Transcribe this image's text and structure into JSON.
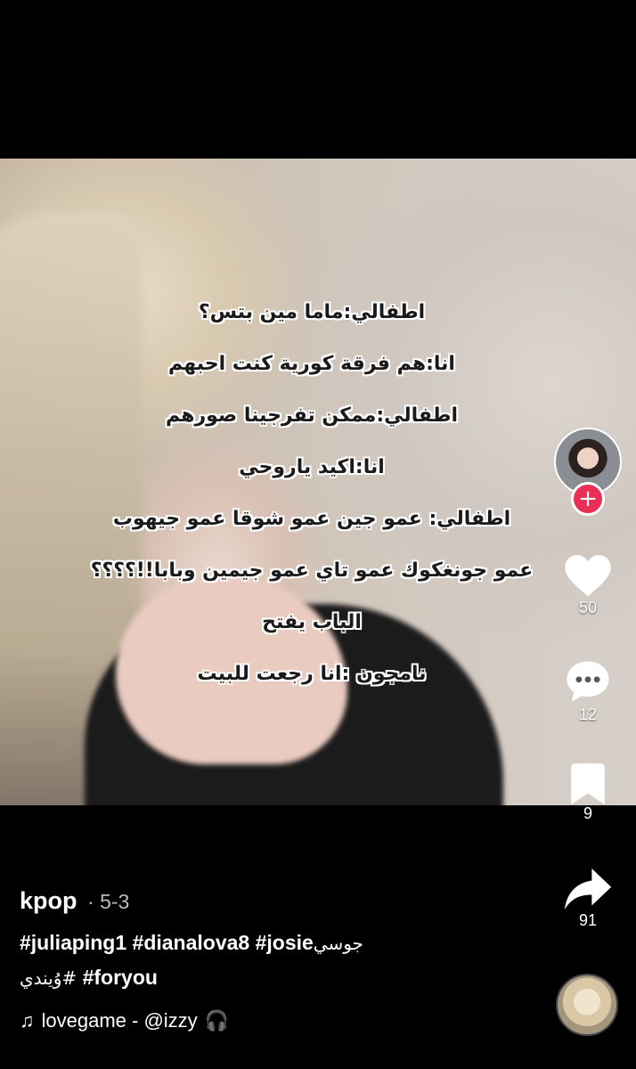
{
  "overlay_lines": [
    "اطفالي:ماما مين بتس؟",
    "انا:هم فرقة كورية كنت احبهم",
    "اطفالي:ممكن تفرجينا صورهم",
    "انا:اكيد ياروحي",
    "اطفالي: عمو جين عمو شوقا عمو جيهوب",
    "عمو جونغكوك عمو تاي عمو جيمين وبابا!!؟؟؟؟",
    "الباب يفتح",
    "نامجون :انا رجعت للبيت"
  ],
  "actions": {
    "follow_symbol": "+",
    "likes": "50",
    "comments": "12",
    "saves": "9",
    "shares": "91"
  },
  "icons": {
    "like": "heart-icon",
    "comment": "comment-bubble-icon",
    "save": "bookmark-icon",
    "share": "share-arrow-icon",
    "music": "music-note-icon",
    "headphones": "headphones-icon"
  },
  "caption": {
    "author": "kpop",
    "date": "· 5-3",
    "hashtags_line1": "#juliaping1 #dianalova8 #josie",
    "hashtags_line1_ar": "جوسي",
    "hashtags_line2_ar": "وُيندي#",
    "hashtags_line2": " #foryou"
  },
  "music": {
    "note": "♫",
    "label": "lovegame - @izzy",
    "headphones": "🎧"
  }
}
